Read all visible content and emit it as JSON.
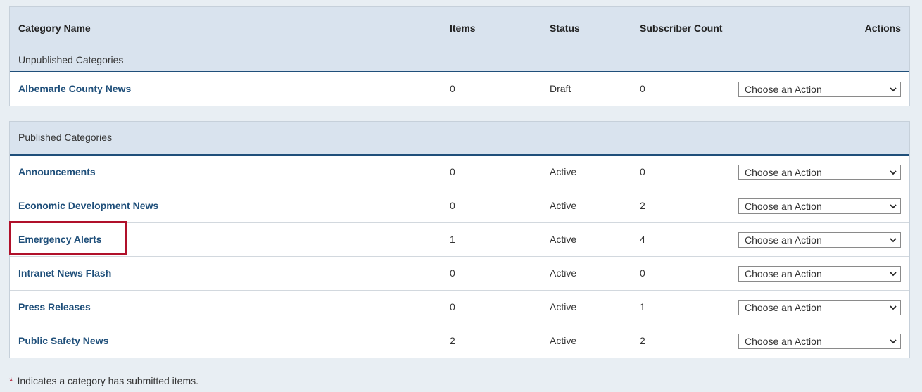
{
  "headers": {
    "category_name": "Category Name",
    "items": "Items",
    "status": "Status",
    "subscriber_count": "Subscriber Count",
    "actions": "Actions"
  },
  "unpublished": {
    "label": "Unpublished Categories",
    "rows": [
      {
        "name": "Albemarle County News",
        "items": "0",
        "status": "Draft",
        "subscribers": "0",
        "action": "Choose an Action"
      }
    ]
  },
  "published": {
    "label": "Published Categories",
    "rows": [
      {
        "name": "Announcements",
        "items": "0",
        "status": "Active",
        "subscribers": "0",
        "action": "Choose an Action"
      },
      {
        "name": "Economic Development News",
        "items": "0",
        "status": "Active",
        "subscribers": "2",
        "action": "Choose an Action"
      },
      {
        "name": "Emergency Alerts",
        "items": "1",
        "status": "Active",
        "subscribers": "4",
        "action": "Choose an Action"
      },
      {
        "name": "Intranet News Flash",
        "items": "0",
        "status": "Active",
        "subscribers": "0",
        "action": "Choose an Action"
      },
      {
        "name": "Press Releases",
        "items": "0",
        "status": "Active",
        "subscribers": "1",
        "action": "Choose an Action"
      },
      {
        "name": "Public Safety News",
        "items": "2",
        "status": "Active",
        "subscribers": "2",
        "action": "Choose an Action"
      }
    ]
  },
  "footnote": {
    "marker": "*",
    "text": "Indicates a category has submitted items."
  },
  "colors": {
    "header_bg": "#d9e3ee",
    "link": "#1f4f7a",
    "highlight": "#b0102a"
  }
}
